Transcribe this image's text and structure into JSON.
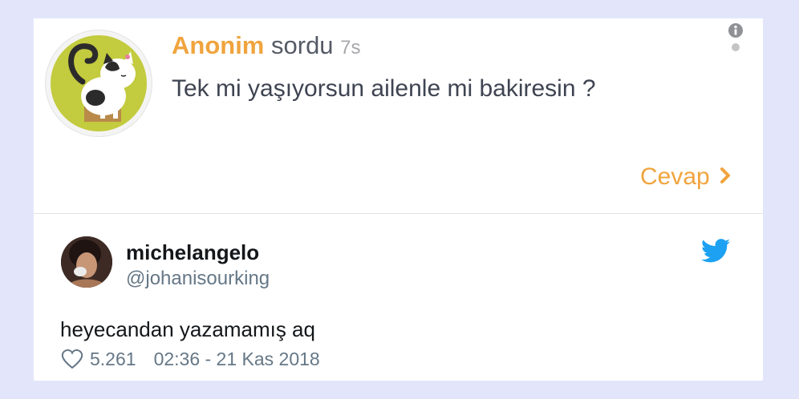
{
  "question": {
    "author": "Anonim",
    "verb": "sordu",
    "time": "7s",
    "text": "Tek mi yaşıyorsun ailenle mi bakiresin ?",
    "answer_label": "Cevap",
    "icons": {
      "avatar": "cat-avatar-icon",
      "menu": "info-icon",
      "answer": "chevron-right-icon"
    }
  },
  "tweet": {
    "name": "michelangelo",
    "handle": "@johanisourking",
    "text": "heyecandan yazamamış aq",
    "likes": "5.261",
    "date": "02:36 - 21 Kas 2018",
    "icons": {
      "brand": "twitter-bird-icon",
      "like": "heart-icon"
    }
  },
  "colors": {
    "background": "#e3e6fb",
    "accent_orange": "#f0a43e",
    "twitter_blue": "#1da1f2",
    "avatar_green": "#c3cb3e"
  }
}
